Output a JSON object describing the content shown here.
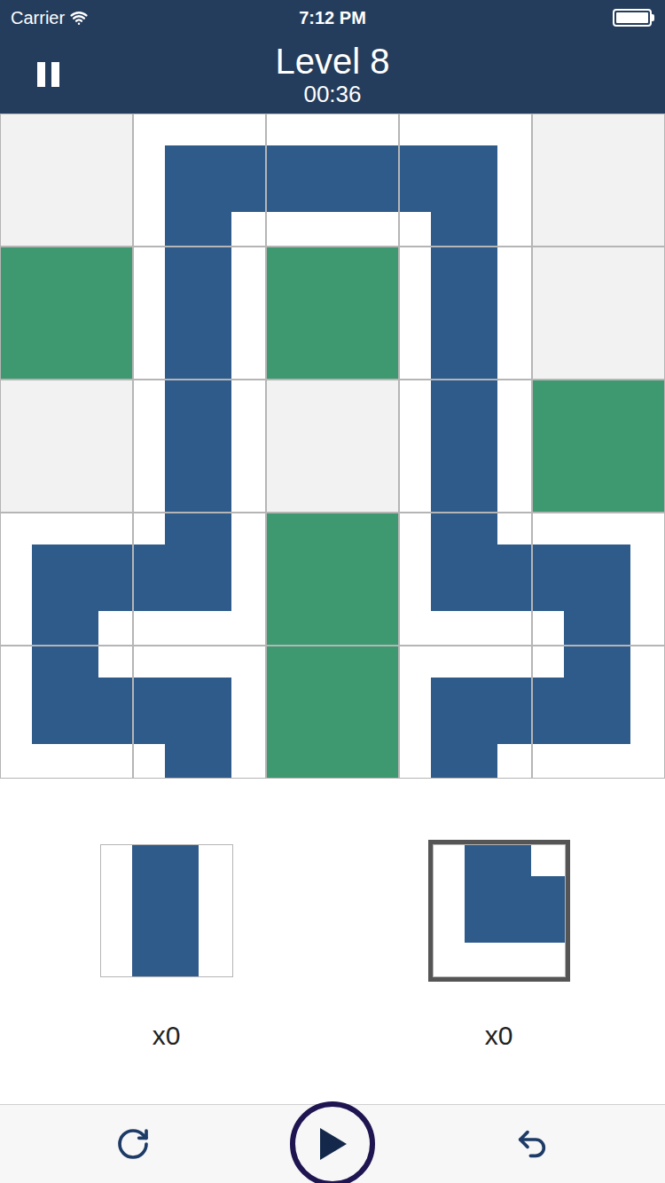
{
  "status_bar": {
    "carrier": "Carrier",
    "time": "7:12 PM",
    "battery_level": 1
  },
  "header": {
    "title": "Level 8",
    "timer": "00:36"
  },
  "board": {
    "rows": [
      [
        {
          "kind": "empty"
        },
        {
          "kind": "pipe",
          "connections": [
            "right",
            "bottom"
          ]
        },
        {
          "kind": "pipe",
          "connections": [
            "left",
            "right"
          ]
        },
        {
          "kind": "pipe",
          "connections": [
            "left",
            "bottom"
          ]
        },
        {
          "kind": "empty"
        }
      ],
      [
        {
          "kind": "block"
        },
        {
          "kind": "pipe",
          "connections": [
            "top",
            "bottom"
          ]
        },
        {
          "kind": "block"
        },
        {
          "kind": "pipe",
          "connections": [
            "top",
            "bottom"
          ]
        },
        {
          "kind": "empty"
        }
      ],
      [
        {
          "kind": "empty"
        },
        {
          "kind": "pipe",
          "connections": [
            "top",
            "bottom"
          ]
        },
        {
          "kind": "empty"
        },
        {
          "kind": "pipe",
          "connections": [
            "top",
            "bottom"
          ]
        },
        {
          "kind": "block"
        }
      ],
      [
        {
          "kind": "pipe",
          "connections": [
            "right",
            "bottom"
          ]
        },
        {
          "kind": "pipe",
          "connections": [
            "top",
            "left"
          ]
        },
        {
          "kind": "block"
        },
        {
          "kind": "pipe",
          "connections": [
            "top",
            "right"
          ]
        },
        {
          "kind": "pipe",
          "connections": [
            "left",
            "bottom"
          ]
        }
      ],
      [
        {
          "kind": "pipe",
          "connections": [
            "top",
            "right"
          ]
        },
        {
          "kind": "pipe",
          "connections": [
            "left",
            "bottom"
          ]
        },
        {
          "kind": "block"
        },
        {
          "kind": "pipe",
          "connections": [
            "right",
            "bottom"
          ]
        },
        {
          "kind": "pipe",
          "connections": [
            "top",
            "left"
          ]
        }
      ]
    ]
  },
  "palette": [
    {
      "kind": "pipe",
      "connections": [
        "top",
        "bottom"
      ],
      "count": "x0",
      "selected": false
    },
    {
      "kind": "pipe",
      "connections": [
        "top",
        "right"
      ],
      "count": "x0",
      "selected": true
    }
  ]
}
